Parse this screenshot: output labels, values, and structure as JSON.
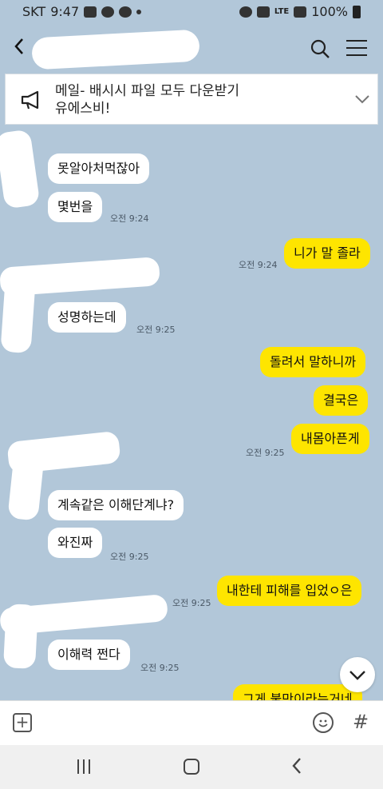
{
  "status_bar": {
    "carrier": "SKT",
    "time": "9:47",
    "network": "LTE",
    "battery": "100%"
  },
  "notice": {
    "line1": "메일- 배시시 파일 모두 다운받기",
    "line2": "유에스비!"
  },
  "messages": [
    {
      "text": "못알아처먹잖아",
      "side": "in"
    },
    {
      "text": "몇번을",
      "side": "in",
      "time": "오전 9:24"
    },
    {
      "text": "니가 말 졸라",
      "side": "out",
      "time": "오전 9:24"
    },
    {
      "text": "성명하는데",
      "side": "in",
      "time": "오전 9:25"
    },
    {
      "text": "돌려서 말하니까",
      "side": "out"
    },
    {
      "text": "결국은",
      "side": "out"
    },
    {
      "text": "내몸아픈게",
      "side": "out",
      "time": "오전 9:25"
    },
    {
      "text": "계속같은 이해단계냐?",
      "side": "in"
    },
    {
      "text": "와진짜",
      "side": "in",
      "time": "오전 9:25"
    },
    {
      "text": "내한테 피해를 입었ㅇ은",
      "side": "out",
      "time": "오전 9:25"
    },
    {
      "text": "이해력 쩐다",
      "side": "in",
      "time": "오전 9:25"
    },
    {
      "text": "그게 불만이라는거네",
      "side": "out"
    }
  ],
  "icons": {
    "back": "back-arrow-icon",
    "search": "search-icon",
    "menu": "menu-icon",
    "notice": "megaphone-icon",
    "expand": "chevron-down-icon",
    "add": "plus-icon",
    "emoji": "emoji-icon",
    "hashtag": "hashtag-icon"
  },
  "colors": {
    "background": "#b2c7d9",
    "outgoing": "#fee500",
    "incoming": "#ffffff"
  }
}
